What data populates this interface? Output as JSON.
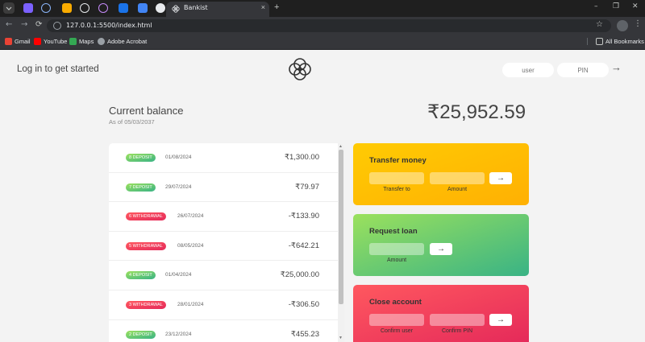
{
  "browser": {
    "tab_title": "Bankist",
    "tab_close": "×",
    "new_tab": "+",
    "url": "127.0.0.1:5500/index.html",
    "win_min": "–",
    "win_max": "❐",
    "win_close": "✕",
    "back": "←",
    "forward": "→",
    "reload": "⟳",
    "star": "☆",
    "kebab": "⋮",
    "bookmarks": [
      {
        "label": "Gmail",
        "icon": "gmail-icon",
        "color": "#ea4335"
      },
      {
        "label": "YouTube",
        "icon": "youtube-icon",
        "color": "#ff0000"
      },
      {
        "label": "Maps",
        "icon": "maps-icon",
        "color": "#34a853"
      },
      {
        "label": "Adobe Acrobat",
        "icon": "adobe-acrobat-icon",
        "color": "#9aa0a6"
      }
    ],
    "all_bookmarks": "All Bookmarks"
  },
  "app": {
    "welcome": "Log in to get started",
    "login": {
      "user_placeholder": "user",
      "pin_placeholder": "PIN",
      "button": "→"
    },
    "balance": {
      "label": "Current balance",
      "date_prefix": "As of",
      "date": "05/03/2037",
      "value": "₹25,952.59"
    },
    "movements": [
      {
        "type": "8 deposit",
        "kind": "dep",
        "date": "01/08/2024",
        "value": "₹1,300.00"
      },
      {
        "type": "7 deposit",
        "kind": "dep",
        "date": "29/07/2024",
        "value": "₹79.97"
      },
      {
        "type": "6 withdrawal",
        "kind": "wd",
        "date": "26/07/2024",
        "value": "-₹133.90"
      },
      {
        "type": "5 withdrawal",
        "kind": "wd",
        "date": "08/05/2024",
        "value": "-₹642.21"
      },
      {
        "type": "4 deposit",
        "kind": "dep",
        "date": "01/04/2024",
        "value": "₹25,000.00"
      },
      {
        "type": "3 withdrawal",
        "kind": "wd",
        "date": "28/01/2024",
        "value": "-₹306.50"
      },
      {
        "type": "2 deposit",
        "kind": "dep",
        "date": "23/12/2024",
        "value": "₹455.23"
      }
    ],
    "scroll_up": "▲",
    "scroll_down": "▼",
    "operations": {
      "transfer": {
        "title": "Transfer money",
        "label_to": "Transfer to",
        "label_amount": "Amount",
        "button": "→"
      },
      "loan": {
        "title": "Request loan",
        "label_amount": "Amount",
        "button": "→"
      },
      "close": {
        "title": "Close account",
        "label_user": "Confirm user",
        "label_pin": "Confirm PIN",
        "button": "→"
      }
    }
  }
}
